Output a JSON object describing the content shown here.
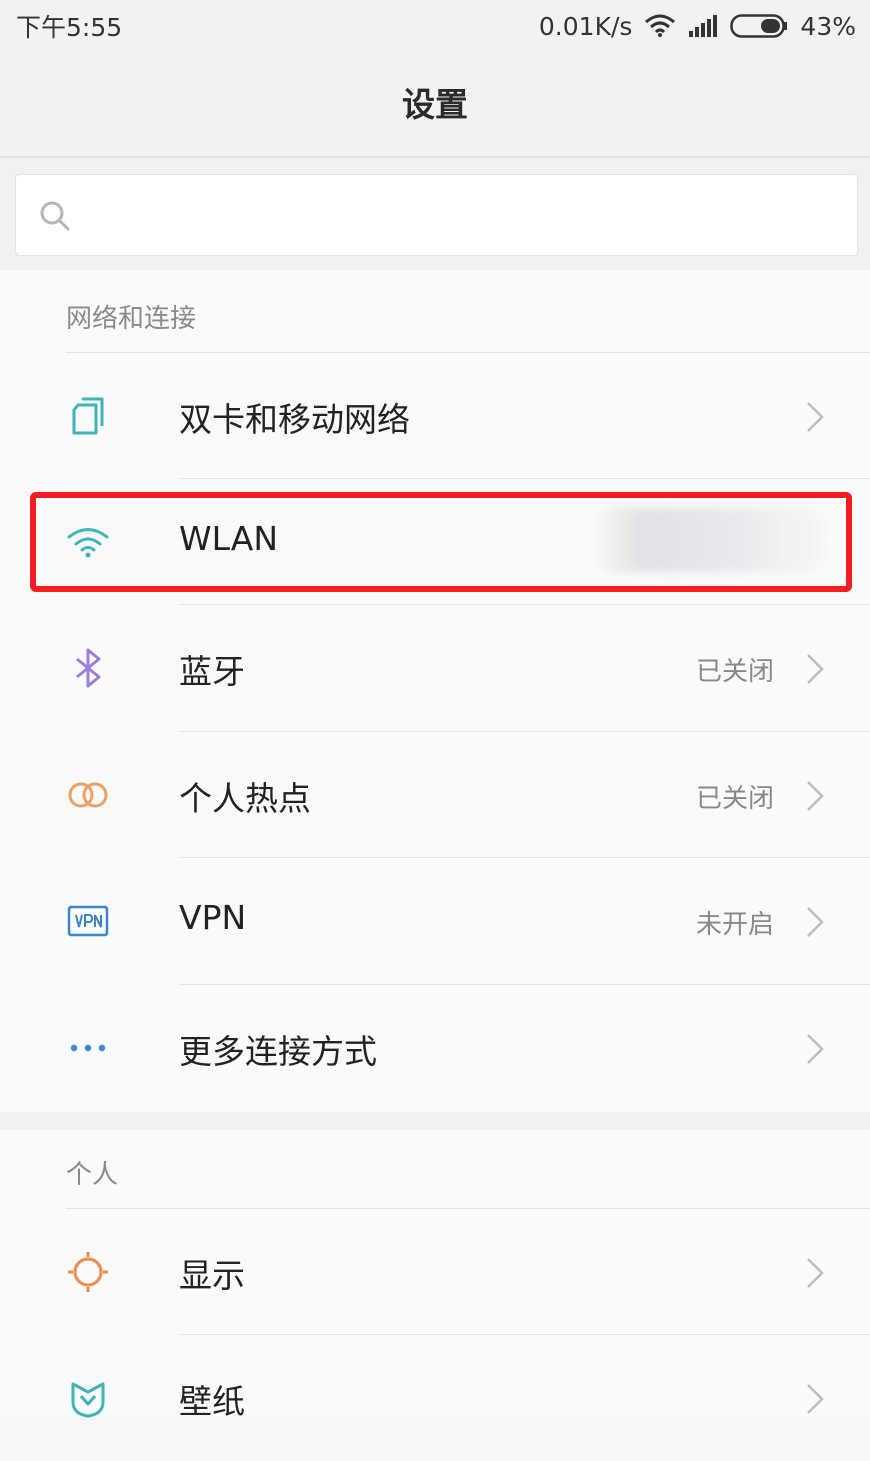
{
  "status_bar": {
    "time": "下午5:55",
    "speed": "0.01K/s",
    "battery": "43%",
    "icons": [
      "wifi-icon",
      "signal-icon",
      "battery-icon"
    ]
  },
  "header": {
    "title": "设置"
  },
  "search": {
    "placeholder": ""
  },
  "sections": {
    "network": {
      "title": "网络和连接",
      "items": [
        {
          "label": "双卡和移动网络",
          "value": "",
          "icon": "sim-card-icon"
        },
        {
          "label": "WLAN",
          "value": "",
          "icon": "wifi-icon",
          "highlighted": true
        },
        {
          "label": "蓝牙",
          "value": "已关闭",
          "icon": "bluetooth-icon"
        },
        {
          "label": "个人热点",
          "value": "已关闭",
          "icon": "hotspot-icon"
        },
        {
          "label": "VPN",
          "value": "未开启",
          "icon": "vpn-icon"
        },
        {
          "label": "更多连接方式",
          "value": "",
          "icon": "more-icon"
        }
      ]
    },
    "personal": {
      "title": "个人",
      "items": [
        {
          "label": "显示",
          "value": "",
          "icon": "display-icon"
        },
        {
          "label": "壁纸",
          "value": "",
          "icon": "wallpaper-icon"
        }
      ]
    }
  },
  "colors": {
    "highlight": "#f41e1e",
    "teal": "#3fb4b8",
    "bluetooth": "#9b7fe0",
    "hotspot": "#f0a060",
    "display": "#ef8a4e"
  }
}
